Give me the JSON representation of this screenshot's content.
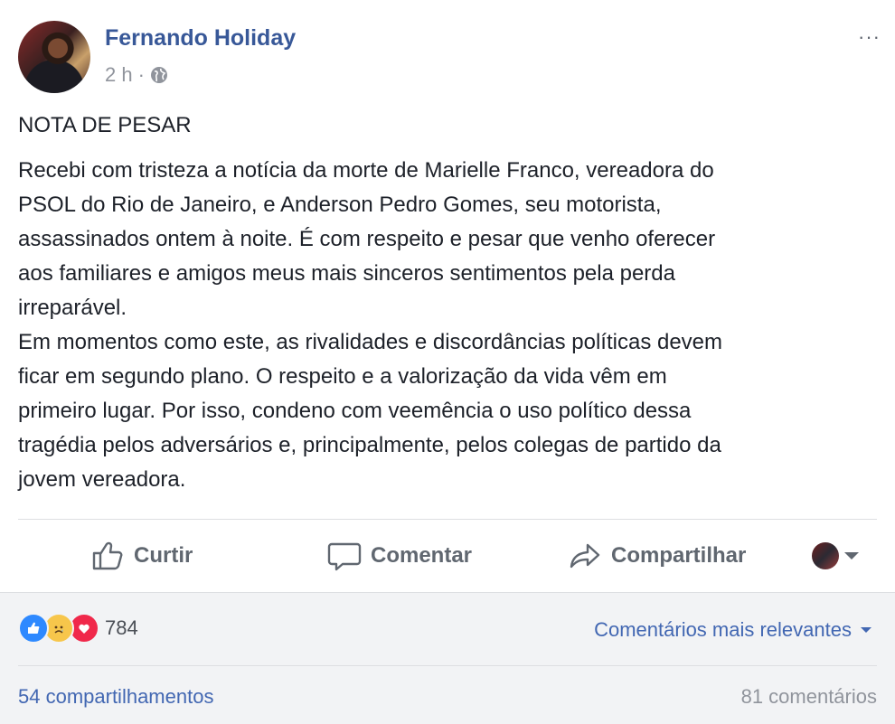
{
  "post": {
    "author": "Fernando Holiday",
    "time": "2 h",
    "separator": "·",
    "more": "···",
    "title": "NOTA DE PESAR",
    "body": "Recebi com tristeza a notícia da morte de Marielle Franco, vereadora do\nPSOL do Rio de Janeiro, e Anderson Pedro Gomes, seu motorista,\nassassinados ontem à noite. É com respeito e pesar que venho oferecer\naos familiares e amigos meus mais sinceros sentimentos pela perda\nirreparável.\nEm momentos como este, as rivalidades e discordâncias políticas devem\nficar em segundo plano. O respeito e a valorização da vida vêm em\nprimeiro lugar. Por isso, condeno com veemência o uso político dessa\ntragédia pelos adversários e, principalmente, pelos colegas de partido da\njovem vereadora."
  },
  "actions": {
    "like": "Curtir",
    "comment": "Comentar",
    "share": "Compartilhar"
  },
  "stats": {
    "reaction_count": "784",
    "sort_label": "Comentários mais relevantes",
    "shares": "54 compartilhamentos",
    "comments": "81 comentários"
  },
  "icons": {
    "like": "thumbs-up-icon",
    "comment": "speech-bubble-icon",
    "share": "share-arrow-icon",
    "privacy": "globe-icon"
  },
  "colors": {
    "link": "#385898",
    "action": "#606770",
    "like_reaction": "#2e89ff",
    "sad_reaction": "#f7c64b",
    "love_reaction": "#f0284a"
  }
}
